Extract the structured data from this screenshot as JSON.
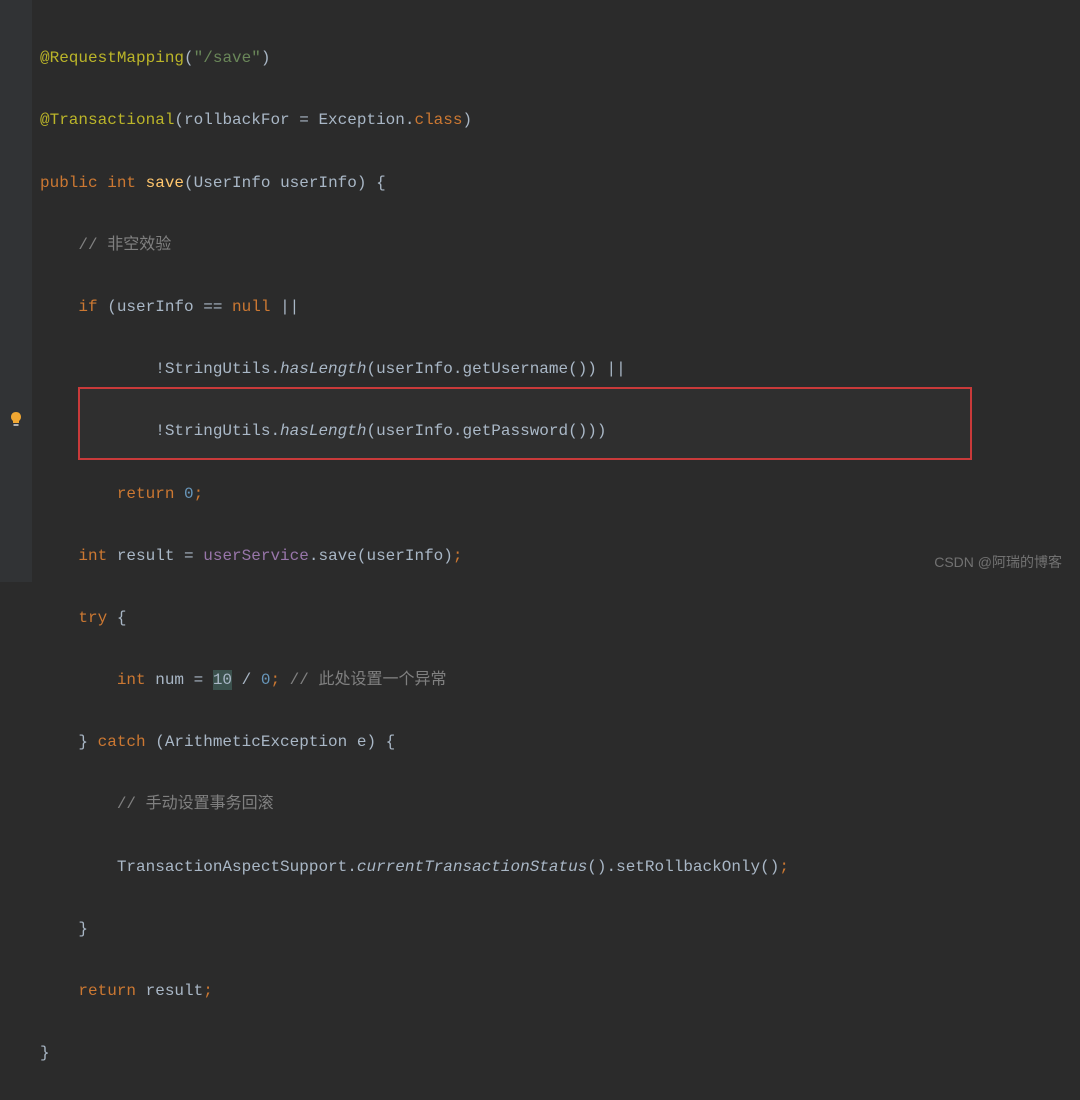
{
  "code": {
    "line1": {
      "annotation": "@RequestMapping",
      "paren_open": "(",
      "string": "\"/save\"",
      "paren_close": ")"
    },
    "line2": {
      "annotation": "@Transactional",
      "paren_open": "(",
      "attr_name": "rollbackFor ",
      "equals": "= ",
      "value": "Exception.",
      "keyword_class": "class",
      "paren_close": ")"
    },
    "line3": {
      "kw_public": "public ",
      "kw_int": "int ",
      "method": "save",
      "paren_open": "(",
      "type": "UserInfo ",
      "param": "userInfo",
      "paren_close": ") {"
    },
    "line4": {
      "indent": "    ",
      "comment": "// 非空效验"
    },
    "line5": {
      "indent": "    ",
      "kw_if": "if ",
      "text": "(userInfo == ",
      "kw_null": "null ",
      "op": "||"
    },
    "line6": {
      "indent": "            ",
      "neg": "!StringUtils.",
      "method": "hasLength",
      "args": "(userInfo.getUsername()) ||"
    },
    "line7": {
      "indent": "            ",
      "neg": "!StringUtils.",
      "method": "hasLength",
      "args": "(userInfo.getPassword()))"
    },
    "line8": {
      "indent": "        ",
      "kw_return": "return ",
      "num": "0",
      "semi": ";"
    },
    "line9": {
      "indent": "    ",
      "kw_int": "int ",
      "var": "result = ",
      "field": "userService",
      "call": ".save(userInfo)",
      "semi": ";"
    },
    "line10": {
      "indent": "    ",
      "kw_try": "try ",
      "brace": "{"
    },
    "line11": {
      "indent": "        ",
      "kw_int": "int ",
      "var": "num = ",
      "num1": "10",
      "op": " / ",
      "num2": "0",
      "semi": "; ",
      "comment": "// 此处设置一个异常"
    },
    "line12": {
      "indent": "    ",
      "brace_close": "} ",
      "kw_catch": "catch ",
      "args": "(ArithmeticException e) {"
    },
    "line13": {
      "indent": "        ",
      "comment": "// 手动设置事务回滚"
    },
    "line14": {
      "indent": "        ",
      "text1": "TransactionAspectSupport.",
      "method": "currentTransactionStatus",
      "text2": "().setRollbackOnly()",
      "semi": ";"
    },
    "line15": {
      "indent": "    ",
      "brace": "}"
    },
    "line16": {
      "indent": "    ",
      "kw_return": "return ",
      "var": "result",
      "semi": ";"
    },
    "line17": {
      "brace": "}"
    }
  },
  "watermark": "CSDN @阿瑞的博客"
}
